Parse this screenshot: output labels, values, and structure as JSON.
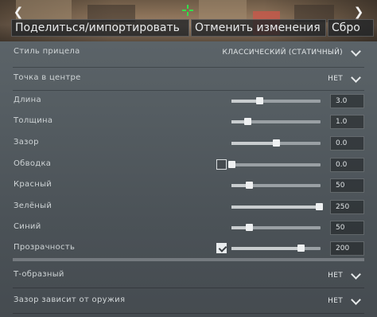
{
  "toolbar": {
    "share_label": "Поделиться/импортировать",
    "reset_label": "Отменить изменения",
    "third_label": "Сбро"
  },
  "settings": {
    "style": {
      "label": "Стиль прицела",
      "value": "КЛАССИЧЕСКИЙ (СТАТИЧНЫЙ)"
    },
    "center_dot": {
      "label": "Точка в центре",
      "value": "НЕТ"
    },
    "length": {
      "label": "Длина",
      "value": "3.0",
      "level": 0.31
    },
    "thickness": {
      "label": "Толщина",
      "value": "1.0",
      "level": 0.18
    },
    "gap": {
      "label": "Зазор",
      "value": "0.0",
      "level": 0.5
    },
    "outline": {
      "label": "Обводка",
      "value": "0.0",
      "level": 0.0,
      "checked": false
    },
    "red": {
      "label": "Красный",
      "value": "50",
      "level": 0.2
    },
    "green": {
      "label": "Зелёный",
      "value": "250",
      "level": 0.98
    },
    "blue": {
      "label": "Синий",
      "value": "50",
      "level": 0.2
    },
    "alpha": {
      "label": "Прозрачность",
      "value": "200",
      "level": 0.78,
      "checked": true
    },
    "t_shape": {
      "label": "Т-образный",
      "value": "НЕТ"
    },
    "weapon_gap": {
      "label": "Зазор зависит от оружия",
      "value": "НЕТ"
    }
  },
  "colors": {
    "crosshair": "#31e04a",
    "accent_sign": "#c8584a"
  },
  "icons": {
    "left": "chevron-left-icon",
    "right": "chevron-right-icon",
    "dropdown": "chevron-down-icon",
    "check": "checkmark-icon"
  }
}
